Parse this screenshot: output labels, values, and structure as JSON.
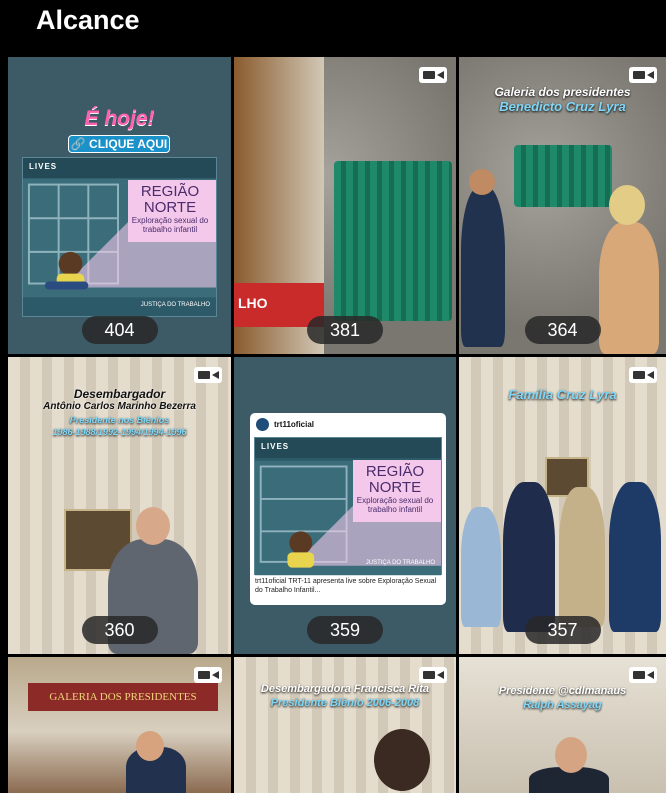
{
  "header": {
    "title": "Alcance"
  },
  "tiles": [
    {
      "count": "404",
      "hoje": "É hoje!",
      "clique": "🔗 CLIQUE AQUI",
      "poster": {
        "lives": "LIVES",
        "title": "REGIÃO NORTE",
        "subtitle": "Exploração sexual do trabalho infantil",
        "brand": "JUSTIÇA DO TRABALHO"
      }
    },
    {
      "count": "381",
      "sign": "LHO"
    },
    {
      "count": "364",
      "caption1": "Galeria dos presidentes",
      "caption2": "Benedicto Cruz Lyra"
    },
    {
      "count": "360",
      "caption1": "Desembargador",
      "caption2": "Antônio Carlos Marinho Bezerra",
      "caption3": "Presidente nos Biênios",
      "caption4": "1986-1988/1992-1994/1994-1996"
    },
    {
      "count": "359",
      "account": "trt11oficial",
      "poster": {
        "lives": "LIVES",
        "title": "REGIÃO NORTE",
        "subtitle": "Exploração sexual do trabalho infantil",
        "brand": "JUSTIÇA DO TRABALHO"
      },
      "desc": "trt11oficial TRT-11 apresenta live sobre Exploração Sexual do Trabalho Infantil..."
    },
    {
      "count": "357",
      "caption1": "Família Cruz Lyra"
    },
    {
      "banner": "GALERIA DOS PRESIDENTES"
    },
    {
      "caption1": "Desembargadora Francisca Rita",
      "caption2": "Presidente Biênio 2006-2008"
    },
    {
      "caption1": "Presidente @cdlmanaus",
      "caption2": "Ralph Assayag"
    }
  ],
  "colors": {
    "background": "#000000",
    "count_pill": "#282828",
    "caption_blue": "#7fd7f7",
    "hoje_pink": "#ff5fae"
  },
  "icons": {
    "video": "video-camera-icon"
  }
}
